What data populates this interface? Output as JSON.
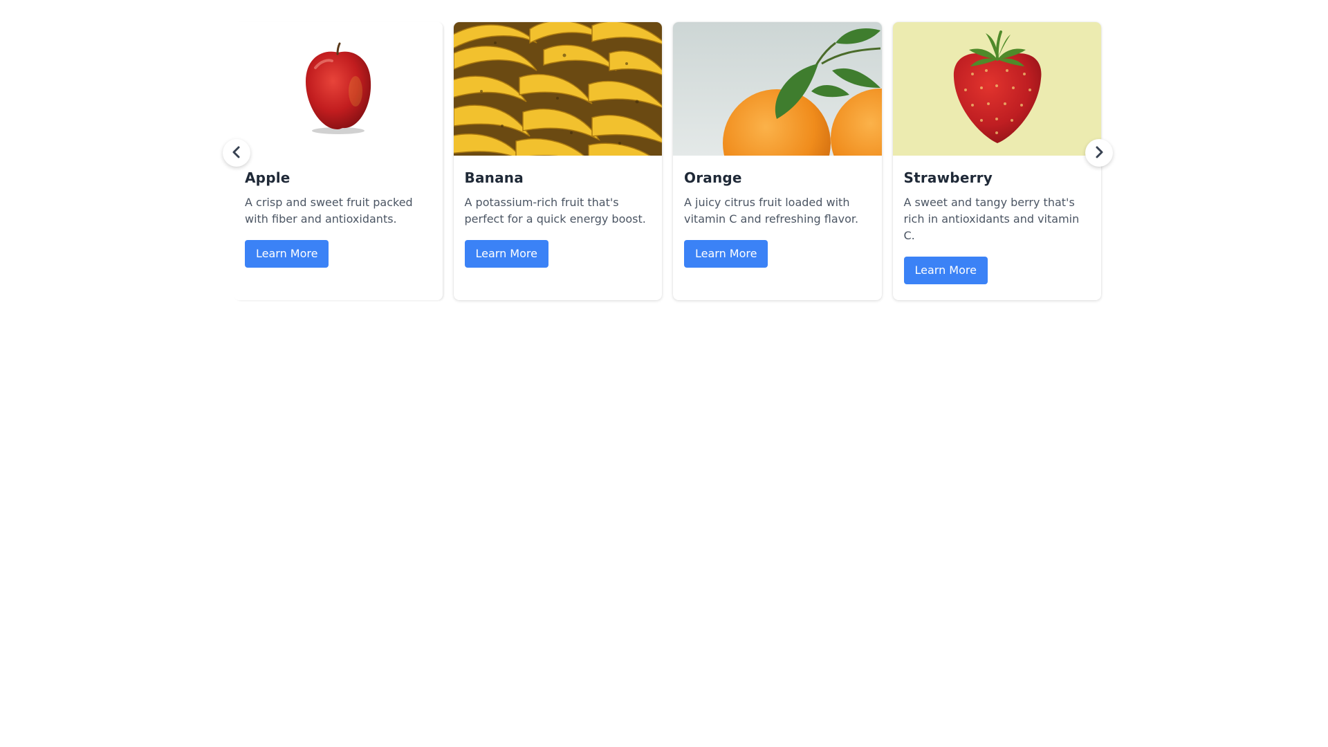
{
  "carousel": {
    "cards": [
      {
        "title": "Apple",
        "description": "A crisp and sweet fruit packed with fiber and antioxidants.",
        "button_label": "Learn More",
        "image": "apple-photo"
      },
      {
        "title": "Banana",
        "description": "A potassium-rich fruit that's perfect for a quick energy boost.",
        "button_label": "Learn More",
        "image": "banana-photo"
      },
      {
        "title": "Orange",
        "description": "A juicy citrus fruit loaded with vitamin C and refreshing flavor.",
        "button_label": "Learn More",
        "image": "orange-photo"
      },
      {
        "title": "Strawberry",
        "description": "A sweet and tangy berry that's rich in antioxidants and vitamin C.",
        "button_label": "Learn More",
        "image": "strawberry-photo"
      }
    ],
    "prev_icon": "chevron-left-icon",
    "next_icon": "chevron-right-icon"
  },
  "colors": {
    "button": "#3b82f6",
    "title": "#1f2937",
    "description": "#4b5563"
  }
}
